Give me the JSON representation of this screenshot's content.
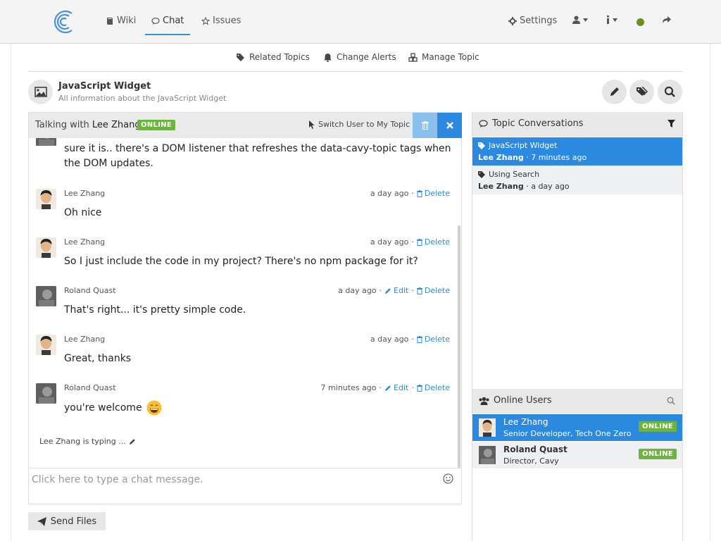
{
  "nav": {
    "wiki": "Wiki",
    "chat": "Chat",
    "issues": "Issues",
    "settings": "Settings",
    "status_color": "#6b8e23",
    "accent": "#3591d6"
  },
  "subnav": {
    "related": "Related Topics",
    "alerts": "Change Alerts",
    "manage": "Manage Topic"
  },
  "topic": {
    "title": "JavaScript Widget",
    "subtitle": "All information about the JavaScript Widget"
  },
  "chat": {
    "talking_prefix": "Talking with",
    "talking_name": "Lee Zhang",
    "status": "ONLINE",
    "switch_user": "Switch User to My Topic",
    "messages": [
      {
        "text": "sure it is.. there's a DOM listener that refreshes the data-cavy-topic tags when the DOM updates."
      },
      {
        "name": "Lee Zhang",
        "time": "a day ago",
        "delete": "Delete",
        "text": "Oh nice"
      },
      {
        "name": "Lee Zhang",
        "time": "a day ago",
        "delete": "Delete",
        "text": "So I just include the code in my project? There's no npm package for it?"
      },
      {
        "name": "Roland Quast",
        "time": "a day ago",
        "edit": "Edit",
        "delete": "Delete",
        "text": "That's right... it's pretty simple code."
      },
      {
        "name": "Lee Zhang",
        "time": "a day ago",
        "delete": "Delete",
        "text": "Great, thanks"
      },
      {
        "name": "Roland Quast",
        "time": "7 minutes ago",
        "edit": "Edit",
        "delete": "Delete",
        "text": "you're welcome"
      }
    ],
    "typing": "Lee Zhang is typing ...",
    "placeholder": "Click here to type a chat message.",
    "send_files": "Send Files"
  },
  "conversations": {
    "title": "Topic Conversations",
    "items": [
      {
        "title": "JavaScript Widget",
        "user": "Lee Zhang",
        "time": "7 minutes ago"
      },
      {
        "title": "Using Search",
        "user": "Lee Zhang",
        "time": "a day ago"
      }
    ]
  },
  "online_users": {
    "title": "Online Users",
    "items": [
      {
        "name": "Lee Zhang",
        "role": "Senior Developer, Tech One Zero",
        "status": "ONLINE"
      },
      {
        "name": "Roland Quast",
        "role": "Director, Cavy",
        "status": "ONLINE"
      }
    ]
  }
}
